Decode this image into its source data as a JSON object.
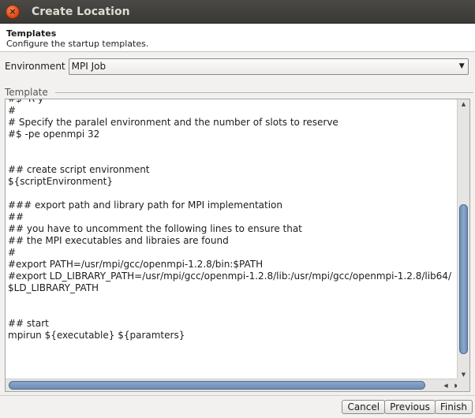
{
  "window": {
    "title": "Create Location"
  },
  "header": {
    "title": "Templates",
    "description": "Configure the startup templates."
  },
  "environment": {
    "label": "Environment",
    "selected": "MPI Job"
  },
  "template": {
    "group_label": "Template",
    "lines": [
      "#$ -R y",
      "#",
      "# Specify the paralel environment and the number of slots to reserve",
      "#$ -pe openmpi 32",
      "",
      "",
      "## create script environment",
      "${scriptEnvironment}",
      "",
      "### export path and library path for MPI implementation",
      "##",
      "## you have to uncomment the following lines to ensure that",
      "## the MPI executables and libraies are found",
      "#",
      "#export PATH=/usr/mpi/gcc/openmpi-1.2.8/bin:$PATH",
      "#export LD_LIBRARY_PATH=/usr/mpi/gcc/openmpi-1.2.8/lib:/usr/mpi/gcc/openmpi-1.2.8/lib64/",
      "$LD_LIBRARY_PATH",
      "",
      "",
      "## start",
      "mpirun ${executable} ${paramters}"
    ]
  },
  "buttons": {
    "cancel": "Cancel",
    "previous": "Previous",
    "finish": "Finish"
  },
  "colors": {
    "titlebar": "#3c3b37",
    "close_button": "#dd4814",
    "scroll_thumb": "#7b98bf"
  },
  "icons": {
    "close": "close-icon",
    "dropdown": "chevron-down-icon"
  }
}
